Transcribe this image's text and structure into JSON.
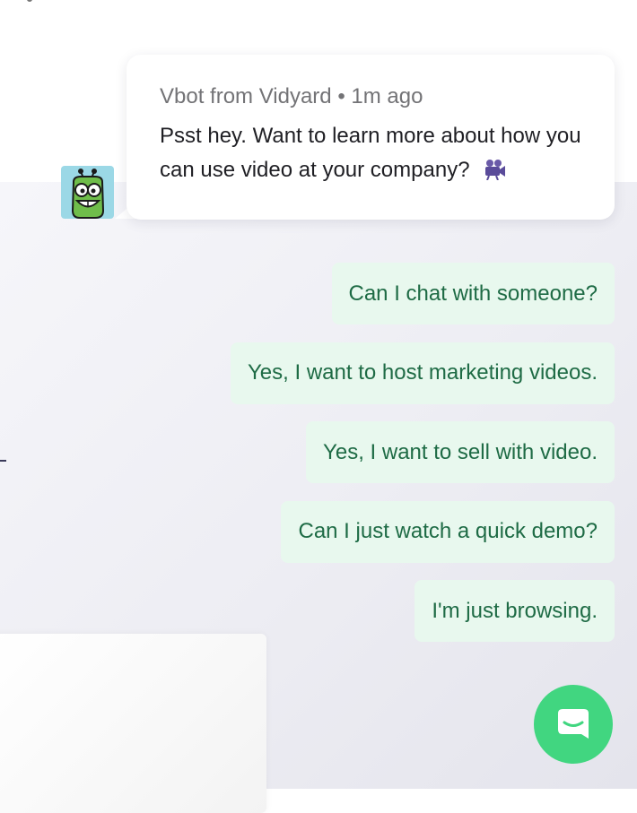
{
  "message": {
    "sender": "Vbot from Vidyard",
    "separator": "•",
    "time": "1m ago",
    "text": "Psst hey. Want to learn more about how you can use video at your company?",
    "emoji_icon": "movie-camera-icon"
  },
  "avatar": {
    "icon": "robot-avatar-icon",
    "background": "#9bd8e6"
  },
  "options": [
    {
      "label": "Can I chat with someone?"
    },
    {
      "label": "Yes, I want to host marketing videos."
    },
    {
      "label": "Yes, I want to sell with video."
    },
    {
      "label": "Can I just watch a quick demo?"
    },
    {
      "label": "I'm just browsing."
    }
  ],
  "launcher": {
    "icon": "chat-bubble-icon",
    "color": "#41d680"
  },
  "colors": {
    "option_bg": "#e8f8ee",
    "option_text": "#1e6b45",
    "meta_text": "#737376",
    "body_text": "#1f1f24"
  }
}
